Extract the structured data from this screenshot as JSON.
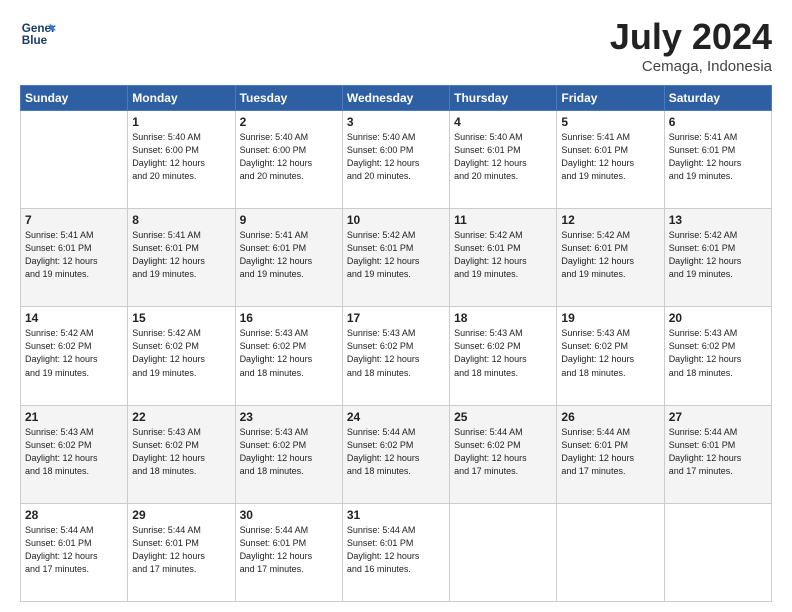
{
  "header": {
    "logo_line1": "General",
    "logo_line2": "Blue",
    "month_year": "July 2024",
    "location": "Cemaga, Indonesia"
  },
  "days_of_week": [
    "Sunday",
    "Monday",
    "Tuesday",
    "Wednesday",
    "Thursday",
    "Friday",
    "Saturday"
  ],
  "weeks": [
    [
      {
        "day": "",
        "info": ""
      },
      {
        "day": "1",
        "info": "Sunrise: 5:40 AM\nSunset: 6:00 PM\nDaylight: 12 hours\nand 20 minutes."
      },
      {
        "day": "2",
        "info": "Sunrise: 5:40 AM\nSunset: 6:00 PM\nDaylight: 12 hours\nand 20 minutes."
      },
      {
        "day": "3",
        "info": "Sunrise: 5:40 AM\nSunset: 6:00 PM\nDaylight: 12 hours\nand 20 minutes."
      },
      {
        "day": "4",
        "info": "Sunrise: 5:40 AM\nSunset: 6:01 PM\nDaylight: 12 hours\nand 20 minutes."
      },
      {
        "day": "5",
        "info": "Sunrise: 5:41 AM\nSunset: 6:01 PM\nDaylight: 12 hours\nand 19 minutes."
      },
      {
        "day": "6",
        "info": "Sunrise: 5:41 AM\nSunset: 6:01 PM\nDaylight: 12 hours\nand 19 minutes."
      }
    ],
    [
      {
        "day": "7",
        "info": "Sunrise: 5:41 AM\nSunset: 6:01 PM\nDaylight: 12 hours\nand 19 minutes."
      },
      {
        "day": "8",
        "info": "Sunrise: 5:41 AM\nSunset: 6:01 PM\nDaylight: 12 hours\nand 19 minutes."
      },
      {
        "day": "9",
        "info": "Sunrise: 5:41 AM\nSunset: 6:01 PM\nDaylight: 12 hours\nand 19 minutes."
      },
      {
        "day": "10",
        "info": "Sunrise: 5:42 AM\nSunset: 6:01 PM\nDaylight: 12 hours\nand 19 minutes."
      },
      {
        "day": "11",
        "info": "Sunrise: 5:42 AM\nSunset: 6:01 PM\nDaylight: 12 hours\nand 19 minutes."
      },
      {
        "day": "12",
        "info": "Sunrise: 5:42 AM\nSunset: 6:01 PM\nDaylight: 12 hours\nand 19 minutes."
      },
      {
        "day": "13",
        "info": "Sunrise: 5:42 AM\nSunset: 6:01 PM\nDaylight: 12 hours\nand 19 minutes."
      }
    ],
    [
      {
        "day": "14",
        "info": "Sunrise: 5:42 AM\nSunset: 6:02 PM\nDaylight: 12 hours\nand 19 minutes."
      },
      {
        "day": "15",
        "info": "Sunrise: 5:42 AM\nSunset: 6:02 PM\nDaylight: 12 hours\nand 19 minutes."
      },
      {
        "day": "16",
        "info": "Sunrise: 5:43 AM\nSunset: 6:02 PM\nDaylight: 12 hours\nand 18 minutes."
      },
      {
        "day": "17",
        "info": "Sunrise: 5:43 AM\nSunset: 6:02 PM\nDaylight: 12 hours\nand 18 minutes."
      },
      {
        "day": "18",
        "info": "Sunrise: 5:43 AM\nSunset: 6:02 PM\nDaylight: 12 hours\nand 18 minutes."
      },
      {
        "day": "19",
        "info": "Sunrise: 5:43 AM\nSunset: 6:02 PM\nDaylight: 12 hours\nand 18 minutes."
      },
      {
        "day": "20",
        "info": "Sunrise: 5:43 AM\nSunset: 6:02 PM\nDaylight: 12 hours\nand 18 minutes."
      }
    ],
    [
      {
        "day": "21",
        "info": "Sunrise: 5:43 AM\nSunset: 6:02 PM\nDaylight: 12 hours\nand 18 minutes."
      },
      {
        "day": "22",
        "info": "Sunrise: 5:43 AM\nSunset: 6:02 PM\nDaylight: 12 hours\nand 18 minutes."
      },
      {
        "day": "23",
        "info": "Sunrise: 5:43 AM\nSunset: 6:02 PM\nDaylight: 12 hours\nand 18 minutes."
      },
      {
        "day": "24",
        "info": "Sunrise: 5:44 AM\nSunset: 6:02 PM\nDaylight: 12 hours\nand 18 minutes."
      },
      {
        "day": "25",
        "info": "Sunrise: 5:44 AM\nSunset: 6:02 PM\nDaylight: 12 hours\nand 17 minutes."
      },
      {
        "day": "26",
        "info": "Sunrise: 5:44 AM\nSunset: 6:01 PM\nDaylight: 12 hours\nand 17 minutes."
      },
      {
        "day": "27",
        "info": "Sunrise: 5:44 AM\nSunset: 6:01 PM\nDaylight: 12 hours\nand 17 minutes."
      }
    ],
    [
      {
        "day": "28",
        "info": "Sunrise: 5:44 AM\nSunset: 6:01 PM\nDaylight: 12 hours\nand 17 minutes."
      },
      {
        "day": "29",
        "info": "Sunrise: 5:44 AM\nSunset: 6:01 PM\nDaylight: 12 hours\nand 17 minutes."
      },
      {
        "day": "30",
        "info": "Sunrise: 5:44 AM\nSunset: 6:01 PM\nDaylight: 12 hours\nand 17 minutes."
      },
      {
        "day": "31",
        "info": "Sunrise: 5:44 AM\nSunset: 6:01 PM\nDaylight: 12 hours\nand 16 minutes."
      },
      {
        "day": "",
        "info": ""
      },
      {
        "day": "",
        "info": ""
      },
      {
        "day": "",
        "info": ""
      }
    ]
  ]
}
